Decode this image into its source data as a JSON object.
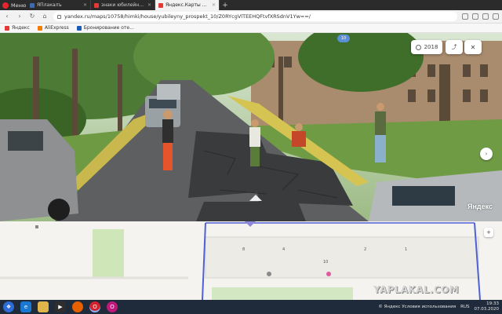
{
  "browser": {
    "menu_label": "Меню",
    "tabs": [
      {
        "title": "ЯПлакалъ",
        "favicon_color": "#3c6bb4",
        "active": false
      },
      {
        "title": "знаки юбилейный прос",
        "favicon_color": "#e53935",
        "active": false
      },
      {
        "title": "Яндекс.Карты — поиск м",
        "favicon_color": "#e53935",
        "active": true
      }
    ],
    "url": "yandex.ru/maps/10758/himki/house/yubileyny_prospekt_10/Z0RYcgVlTEEHQFtvfXRSdnV1Yw==/",
    "bookmarks": [
      {
        "label": "Яндекс",
        "color": "#e53935"
      },
      {
        "label": "AliExpress",
        "color": "#f57c00"
      },
      {
        "label": "Бронирование оте...",
        "color": "#1e5bb8"
      }
    ]
  },
  "panorama": {
    "year_label": "2018",
    "marker_label": "10",
    "watermark": "Яндекс"
  },
  "map": {
    "house_numbers": [
      "8",
      "4",
      "10",
      "2",
      "1"
    ]
  },
  "page_watermark": "YAPLAKAL.COM",
  "taskbar": {
    "attribution": "© Яндекс Условия использования",
    "lang": "RUS",
    "time": "19:33",
    "date": "07.03.2020"
  }
}
